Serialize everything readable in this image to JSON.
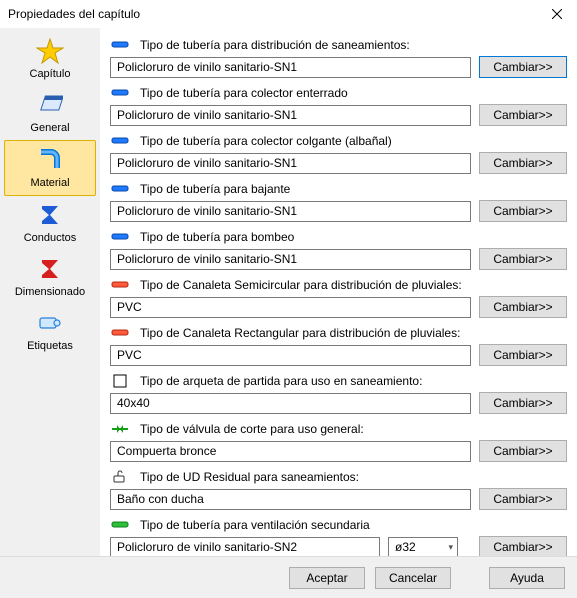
{
  "window": {
    "title": "Propiedades del capítulo"
  },
  "sidebar": {
    "items": [
      {
        "label": "Capítulo"
      },
      {
        "label": "General"
      },
      {
        "label": "Material"
      },
      {
        "label": "Conductos"
      },
      {
        "label": "Dimensionado"
      },
      {
        "label": "Etiquetas"
      }
    ]
  },
  "rows": [
    {
      "label": "Tipo de tubería para distribución de saneamientos:",
      "value": "Policloruro de vinilo sanitario-SN1",
      "icon": "pipe-blue",
      "button": "Cambiar>>",
      "accent": true
    },
    {
      "label": "Tipo de tubería para colector enterrado",
      "value": "Policloruro de vinilo sanitario-SN1",
      "icon": "pipe-blue",
      "button": "Cambiar>>"
    },
    {
      "label": "Tipo de tubería para colector colgante (albañal)",
      "value": "Policloruro de vinilo sanitario-SN1",
      "icon": "pipe-blue",
      "button": "Cambiar>>"
    },
    {
      "label": "Tipo de tubería para bajante",
      "value": "Policloruro de vinilo sanitario-SN1",
      "icon": "pipe-blue",
      "button": "Cambiar>>"
    },
    {
      "label": "Tipo de tubería para bombeo",
      "value": "Policloruro de vinilo sanitario-SN1",
      "icon": "pipe-blue",
      "button": "Cambiar>>"
    },
    {
      "label": "Tipo de Canaleta Semicircular para distribución de pluviales:",
      "value": "PVC",
      "icon": "pipe-red",
      "button": "Cambiar>>"
    },
    {
      "label": "Tipo de Canaleta Rectangular para distribución de pluviales:",
      "value": "PVC",
      "icon": "pipe-red",
      "button": "Cambiar>>"
    },
    {
      "label": "Tipo de arqueta de partida para uso en saneamiento:",
      "value": "40x40",
      "icon": "box",
      "button": "Cambiar>>"
    },
    {
      "label": "Tipo de válvula de corte para uso general:",
      "value": "Compuerta bronce",
      "icon": "valve",
      "button": "Cambiar>>"
    },
    {
      "label": "Tipo de UD Residual para saneamientos:",
      "value": "Baño con ducha",
      "icon": "fixture",
      "button": "Cambiar>>"
    },
    {
      "label": "Tipo de tubería para ventilación secundaria",
      "value": "Policloruro de vinilo sanitario-SN2",
      "icon": "pipe-green",
      "button": "Cambiar>>",
      "select": "ø32"
    }
  ],
  "footer": {
    "accept": "Aceptar",
    "cancel": "Cancelar",
    "help": "Ayuda"
  }
}
